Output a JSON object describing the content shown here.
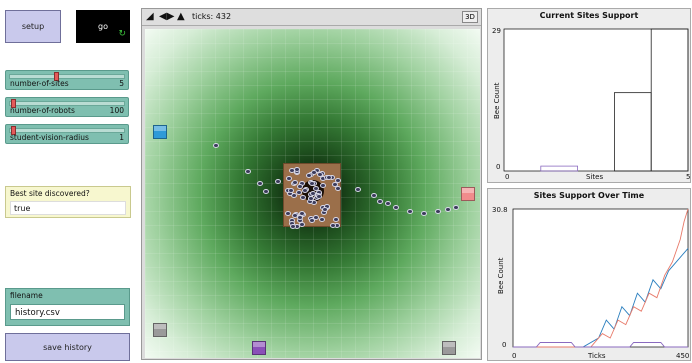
{
  "buttons": {
    "setup": "setup",
    "go": "go",
    "save_history": "save history"
  },
  "sliders": [
    {
      "label": "number-of-sites",
      "value": "5",
      "fraction": 0.4
    },
    {
      "label": "number-of-robots",
      "value": "100",
      "fraction": 0.02
    },
    {
      "label": "student-vision-radius",
      "value": "1",
      "fraction": 0.02
    }
  ],
  "monitor": {
    "label": "Best site discovered?",
    "value": "true"
  },
  "filename": {
    "label": "filename",
    "value": "history.csv"
  },
  "view": {
    "ticks_label": "ticks: 432",
    "three_d": "3D"
  },
  "colors": {
    "accent_go": "#3cc43c",
    "slider_bg": "#7fbfb0",
    "button_bg": "#c9c9ec"
  },
  "plot1": {
    "title": "Current Sites Support",
    "ylabel": "Bee Count",
    "xlabel": "Sites",
    "xmin": "0",
    "xmax": "5",
    "ymin": "0",
    "ymax": "29"
  },
  "plot2": {
    "title": "Sites Support Over Time",
    "ylabel": "Bee Count",
    "xlabel": "Ticks",
    "xmin": "0",
    "xmax": "450",
    "ymin": "0",
    "ymax": "30.8"
  },
  "chart_data": [
    {
      "type": "bar",
      "title": "Current Sites Support",
      "xlabel": "Sites",
      "ylabel": "Bee Count",
      "xlim": [
        0,
        5
      ],
      "ylim": [
        0,
        29
      ],
      "categories": [
        "0",
        "1",
        "2",
        "3",
        "4"
      ],
      "values": [
        0,
        1,
        0,
        16,
        29
      ]
    },
    {
      "type": "line",
      "title": "Sites Support Over Time",
      "xlabel": "Ticks",
      "ylabel": "Bee Count",
      "xlim": [
        0,
        450
      ],
      "ylim": [
        0,
        30.8
      ],
      "series": [
        {
          "color": "#2a7fbf",
          "x": [
            0,
            180,
            220,
            240,
            260,
            280,
            300,
            320,
            340,
            360,
            380,
            400,
            420,
            440,
            450
          ],
          "y": [
            0,
            0,
            2,
            6,
            4,
            9,
            7,
            12,
            10,
            15,
            13,
            17,
            19,
            21,
            22
          ]
        },
        {
          "color": "#e87a6a",
          "x": [
            0,
            200,
            230,
            250,
            270,
            290,
            310,
            330,
            350,
            370,
            390,
            410,
            430,
            440,
            450
          ],
          "y": [
            0,
            0,
            3,
            2,
            6,
            5,
            9,
            8,
            12,
            11,
            16,
            19,
            24,
            28,
            30.8
          ]
        },
        {
          "color": "#8a6abf",
          "x": [
            0,
            60,
            70,
            150,
            160,
            300,
            310,
            380,
            390,
            450
          ],
          "y": [
            0,
            0,
            1,
            1,
            0,
            0,
            1,
            1,
            0,
            0
          ]
        }
      ]
    }
  ]
}
